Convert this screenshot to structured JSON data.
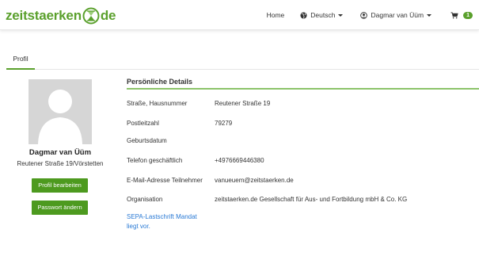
{
  "brand": {
    "logo_left": "zeitstaerken",
    "logo_right": "de",
    "accent": "#5aa02c"
  },
  "nav": {
    "home": "Home",
    "language": "Deutsch",
    "user": "Dagmar van Üüm",
    "cart_count": "1",
    "globe_icon": "globe-icon",
    "user_icon": "user-icon",
    "cart_icon": "cart-icon"
  },
  "tabs": [
    {
      "label": "Profil",
      "active": true
    }
  ],
  "profile": {
    "name": "Dagmar van Üüm",
    "address": "Reutener Straße 19/Vörstetten",
    "edit_button": "Profil bearbeiten",
    "password_button": "Passwort ändern"
  },
  "details": {
    "title": "Persönliche Details",
    "rows": [
      {
        "label": "Straße, Hausnummer",
        "value": "Reutener Straße 19"
      },
      {
        "label": "Postleitzahl",
        "value": "79279"
      },
      {
        "label": "Geburtsdatum",
        "value": ""
      },
      {
        "label": "Telefon geschäftlich",
        "value": "+4976669446380"
      },
      {
        "label": "E-Mail-Adresse Teilnehmer",
        "value": "vanueuem@zeitstaerken.de"
      },
      {
        "label": "Organisation",
        "value": "zeitstaerken.de Gesellschaft für Aus- und Fortbildung mbH & Co. KG"
      }
    ],
    "sepa_line1": "SEPA-Lastschrift Mandat",
    "sepa_line2": "liegt vor."
  }
}
